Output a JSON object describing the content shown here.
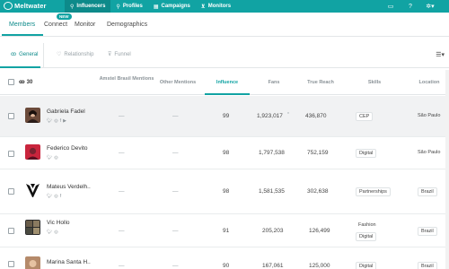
{
  "brand": {
    "name": "Meltwater",
    "color": "#11a3a3"
  },
  "topnav": [
    {
      "icon": "influencers-icon",
      "label": "Influencers",
      "active": true
    },
    {
      "icon": "profiles-icon",
      "label": "Profiles"
    },
    {
      "icon": "campaigns-icon",
      "label": "Campaigns"
    },
    {
      "icon": "monitors-icon",
      "label": "Monitors"
    }
  ],
  "subnav": {
    "items": [
      "Members",
      "Connect",
      "Monitor",
      "Demographics"
    ],
    "new_badge": "NEW"
  },
  "tabs": [
    "General",
    "Relationship",
    "Funnel"
  ],
  "table": {
    "count": "30",
    "headers": {
      "amstel": "Amstel Brasil Mentions",
      "other": "Other Mentions",
      "influence": "Influence",
      "fans": "Fans",
      "reach": "True Reach",
      "skills": "Skills",
      "location": "Location"
    },
    "rows": [
      {
        "name": "Gabriela Fadel",
        "socials": [
          "twitter",
          "instagram",
          "facebook",
          "youtube"
        ],
        "amstel": "—",
        "other": "—",
        "influence": "99",
        "fans": "1,923,017",
        "fans_note": "*",
        "reach": "436,870",
        "skills": [
          "CEP"
        ],
        "location": "São Paulo"
      },
      {
        "name": "Federico Devito",
        "socials": [
          "twitter",
          "instagram"
        ],
        "amstel": "—",
        "other": "—",
        "influence": "98",
        "fans": "1,797,538",
        "reach": "752,159",
        "skills": [
          "Digital"
        ],
        "location": "São Paulo"
      },
      {
        "name": "Mateus Verdelh..",
        "socials": [
          "twitter",
          "instagram",
          "facebook"
        ],
        "amstel": "—",
        "other": "—",
        "influence": "98",
        "fans": "1,581,535",
        "reach": "302,638",
        "skills": [
          "Partnerships"
        ],
        "location": "Brazil"
      },
      {
        "name": "Vic Hollo",
        "socials": [
          "twitter",
          "instagram"
        ],
        "amstel": "—",
        "other": "—",
        "influence": "91",
        "fans": "205,203",
        "reach": "126,499",
        "skills": [
          "Fashion",
          "Digital"
        ],
        "location": "Brazil"
      },
      {
        "name": "Marina Santa H..",
        "socials": [],
        "amstel": "—",
        "other": "—",
        "influence": "90",
        "fans": "167,061",
        "reach": "125,000",
        "skills": [
          "Digital"
        ],
        "location": "Brazil"
      }
    ]
  }
}
